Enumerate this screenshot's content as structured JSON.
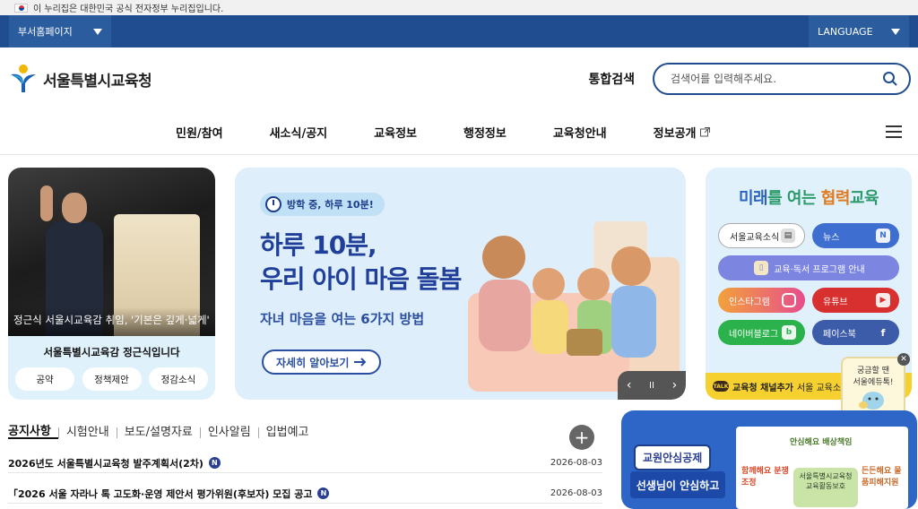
{
  "gov_bar": {
    "text": "이 누리집은 대한민국 공식 전자정부 누리집입니다."
  },
  "util": {
    "dept_label": "부서홈페이지",
    "language_label": "LANGUAGE"
  },
  "header": {
    "logo_text": "서울특별시교육청",
    "search_label": "통합검색",
    "search_placeholder": "검색어를 입력해주세요."
  },
  "nav": {
    "items": [
      "민원/참여",
      "새소식/공지",
      "교육정보",
      "행정정보",
      "교육청안내",
      "정보공개"
    ]
  },
  "left_card": {
    "caption": "정근식 서울시교육감 취임, '기본은 깊게·넓게'",
    "title": "서울특별시교육감 정근식입니다",
    "pills": [
      "공약",
      "정책제안",
      "정감소식"
    ]
  },
  "banner": {
    "badge": "방학 중, 하루 10분!",
    "headline_1": "하루 10분,",
    "headline_2": "우리 아이 마음 돌봄",
    "sub": "자녀 마음을 여는 6가지 방법",
    "button": "자세히 알아보기",
    "controls": {
      "prev": "‹",
      "pause": "II",
      "next": "›"
    }
  },
  "right_card": {
    "title_a": "미래",
    "title_b": "를 여는 ",
    "title_c": "협력",
    "title_d": "교육",
    "buttons": [
      {
        "label": "서울교육소식",
        "icon": "tv-icon"
      },
      {
        "label": "뉴스",
        "icon": "naver-icon"
      },
      {
        "label": "교육·독서 프로그램 안내",
        "icon": "book-icon"
      },
      {
        "label": "인스타그램",
        "icon": "instagram-icon"
      },
      {
        "label": "유튜브",
        "icon": "youtube-icon"
      },
      {
        "label": "네이버블로그",
        "icon": "blog-icon"
      },
      {
        "label": "페이스북",
        "icon": "facebook-icon"
      }
    ],
    "talk": "교육청 채널추가",
    "talk_sub": "서울 교육소식을"
  },
  "float_card": {
    "line1": "궁금할 땐",
    "line2": "서울에듀톡!"
  },
  "notices": {
    "tabs": [
      "공지사항",
      "시험안내",
      "보도/설명자료",
      "인사알림",
      "입법예고"
    ],
    "rows": [
      {
        "title": "2026년도 서울특별시교육청 발주계획서(2차)",
        "date": "2026-08-03"
      },
      {
        "title": "「2026 서울 자라나 톡 고도화·운영 제안서 평가위원(후보자) 모집 공고",
        "date": "2026-08-03"
      }
    ]
  },
  "promo": {
    "badge": "교원안심공제",
    "sub": "선생님이 안심하고",
    "r1": "안심해요 배상책임",
    "r2": "함께해요 분쟁조정",
    "r3": "든든해요 물품피해지원",
    "r4": "서울특별시교육청 교육활동보호"
  },
  "colors": {
    "brand": "#1f4d8f",
    "banner_text": "#1f3f9a"
  }
}
